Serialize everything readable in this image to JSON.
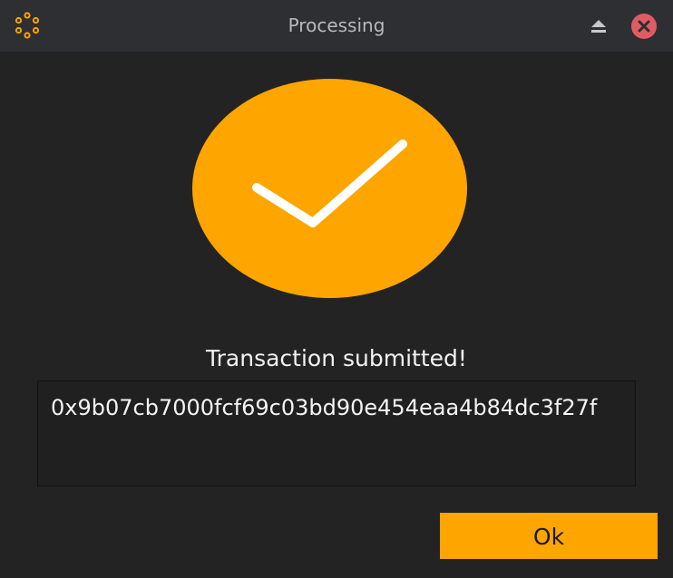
{
  "window": {
    "title": "Processing"
  },
  "icons": {
    "app": "app-logo-icon",
    "eject": "eject-icon",
    "close": "close-icon",
    "success": "checkmark-icon"
  },
  "colors": {
    "accent": "#ffa500",
    "close_button": "#e05c65",
    "background": "#232323",
    "titlebar": "#2e2f33"
  },
  "dialog": {
    "status": "Transaction submitted!",
    "transaction_hash": "0x9b07cb7000fcf69c03bd90e454eaa4b84dc3f27f",
    "ok_label": "Ok"
  }
}
